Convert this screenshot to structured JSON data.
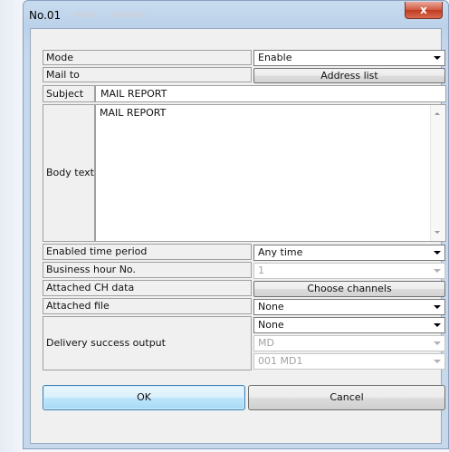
{
  "window": {
    "title": "No.01"
  },
  "icons": {
    "close": "close-icon",
    "dropdown": "chevron-down-icon"
  },
  "labels": {
    "mode": "Mode",
    "mail_to": "Mail to",
    "subject": "Subject",
    "body_text": "Body text",
    "enabled_time_period": "Enabled time period",
    "business_hour_no": "Business hour No.",
    "attached_ch_data": "Attached CH data",
    "attached_file": "Attached file",
    "delivery_success_output": "Delivery success output"
  },
  "values": {
    "mode": "Enable",
    "subject": "MAIL REPORT",
    "body_text": "MAIL REPORT",
    "enabled_time_period": "Any time",
    "business_hour_no": "1",
    "attached_file": "None",
    "delivery_output_1": "None",
    "delivery_output_2": "MD",
    "delivery_output_3": "001 MD1"
  },
  "buttons": {
    "address_list": "Address list",
    "choose_channels": "Choose channels",
    "ok": "OK",
    "cancel": "Cancel",
    "close": "x"
  },
  "colors": {
    "close_button": "#c03b22",
    "default_button_border": "#3c7fb1"
  }
}
